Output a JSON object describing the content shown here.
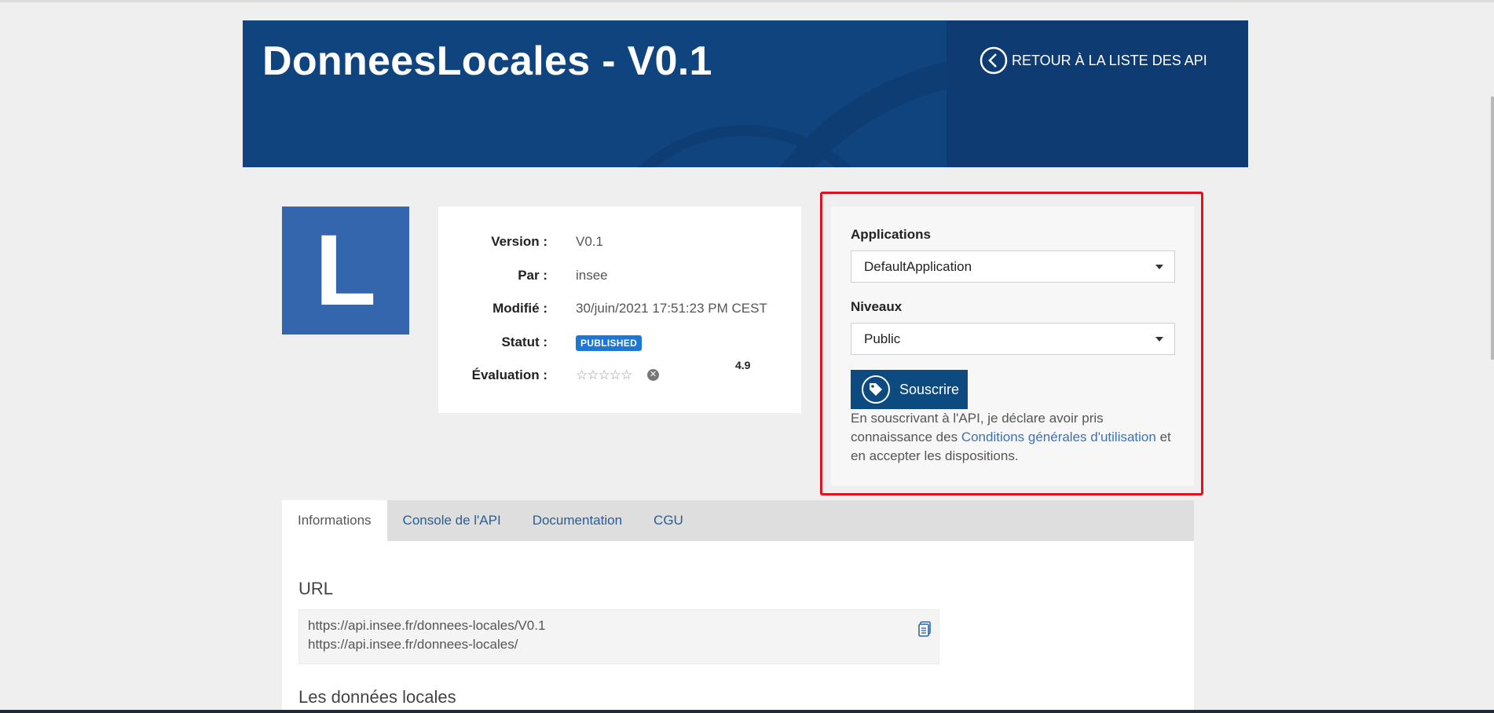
{
  "header": {
    "title": "DonneesLocales - V0.1",
    "back_label": "RETOUR À LA LISTE DES API",
    "banner_color": "#10447f"
  },
  "logo": {
    "letter": "L",
    "color": "#3366ad"
  },
  "info": {
    "version_label": "Version :",
    "version_value": "V0.1",
    "author_label": "Par :",
    "author_value": "insee",
    "modified_label": "Modifié :",
    "modified_value": "30/juin/2021 17:51:23 PM CEST",
    "status_label": "Statut :",
    "status_value": "PUBLISHED",
    "rating_label": "Évaluation :",
    "rating_stars": "☆☆☆☆☆",
    "rating_value": "4.9"
  },
  "subscription": {
    "applications_label": "Applications",
    "applications_value": "DefaultApplication",
    "levels_label": "Niveaux",
    "levels_value": "Public",
    "subscribe_label": "Souscrire",
    "legal_prefix": "En souscrivant à l'API, je déclare avoir pris connaissance des",
    "legal_link": "Conditions générales d'utilisation",
    "legal_suffix": "et en accepter les dispositions.",
    "highlight_color": "#e3101d"
  },
  "tabs": [
    {
      "label": "Informations"
    },
    {
      "label": "Console de l'API"
    },
    {
      "label": "Documentation"
    },
    {
      "label": "CGU"
    }
  ],
  "content": {
    "url_title": "URL",
    "urls": [
      "https://api.insee.fr/donnees-locales/V0.1",
      "https://api.insee.fr/donnees-locales/"
    ],
    "next_section_title": "Les données locales"
  }
}
